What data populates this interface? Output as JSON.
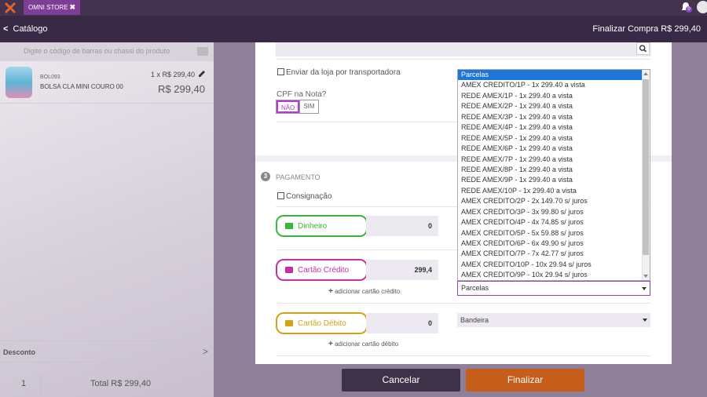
{
  "topbar": {
    "tab_label": "OMNI STORE",
    "tab_close": "✖",
    "notification_count": "0"
  },
  "header": {
    "back_label": "Catálogo",
    "finalize_label": "Finalizar Compra  R$ 299,40"
  },
  "left": {
    "search_placeholder": "Digite o código de barras ou chassi do produto",
    "item": {
      "sku": "BOL093",
      "name": "BOLSA CLA MINI COURO 00",
      "qty_price": "1 x R$ 299,40",
      "price": "R$ 299,40"
    },
    "discount_label": "Desconto",
    "count": "1",
    "total": "Total R$ 299,40"
  },
  "delivery": {
    "ship_label": "Enviar da loja por transportadora",
    "cpf_label": "CPF na Nota?",
    "no": "NÃO",
    "yes": "SIM"
  },
  "payment": {
    "step": "3",
    "title": "PAGAMENTO",
    "consignment_label": "Consignação",
    "cash": {
      "label": "Dinheiro",
      "value": "0"
    },
    "credit": {
      "label": "Cartão Crédito",
      "value": "299,4",
      "add": "adicionar cartão crédito"
    },
    "debit": {
      "label": "Cartão Débito",
      "value": "0",
      "add": "adicionar cartão débito"
    },
    "installments_select": "Parcelas",
    "brand_select": "Bandeira",
    "colors": {
      "cash": "#3db43d",
      "credit": "#c62fa8",
      "debit": "#d3a218",
      "accent": "#8c46c4"
    }
  },
  "dropdown": {
    "options": [
      "Parcelas",
      "AMEX CREDITO/1P - 1x 299.40 a vista",
      "REDE AMEX/1P - 1x 299.40 a vista",
      "REDE AMEX/2P - 1x 299.40 a vista",
      "REDE AMEX/3P - 1x 299.40 a vista",
      "REDE AMEX/4P - 1x 299.40 a vista",
      "REDE AMEX/5P - 1x 299.40 a vista",
      "REDE AMEX/6P - 1x 299.40 a vista",
      "REDE AMEX/7P - 1x 299.40 a vista",
      "REDE AMEX/8P - 1x 299.40 a vista",
      "REDE AMEX/9P - 1x 299.40 a vista",
      "REDE AMEX/10P - 1x 299.40 a vista",
      "AMEX CREDITO/2P - 2x 149.70 s/ juros",
      "AMEX CREDITO/3P - 3x 99.80 s/ juros",
      "AMEX CREDITO/4P - 4x 74.85 s/ juros",
      "AMEX CREDITO/5P - 5x 59.88 s/ juros",
      "AMEX CREDITO/6P - 6x 49.90 s/ juros",
      "AMEX CREDITO/7P - 7x 42.77 s/ juros",
      "AMEX CREDITO/10P - 10x 29.94 s/ juros",
      "AMEX CREDITO/9P - 10x 29.94 s/ juros"
    ]
  },
  "actions": {
    "cancel": "Cancelar",
    "finalize": "Finalizar"
  }
}
